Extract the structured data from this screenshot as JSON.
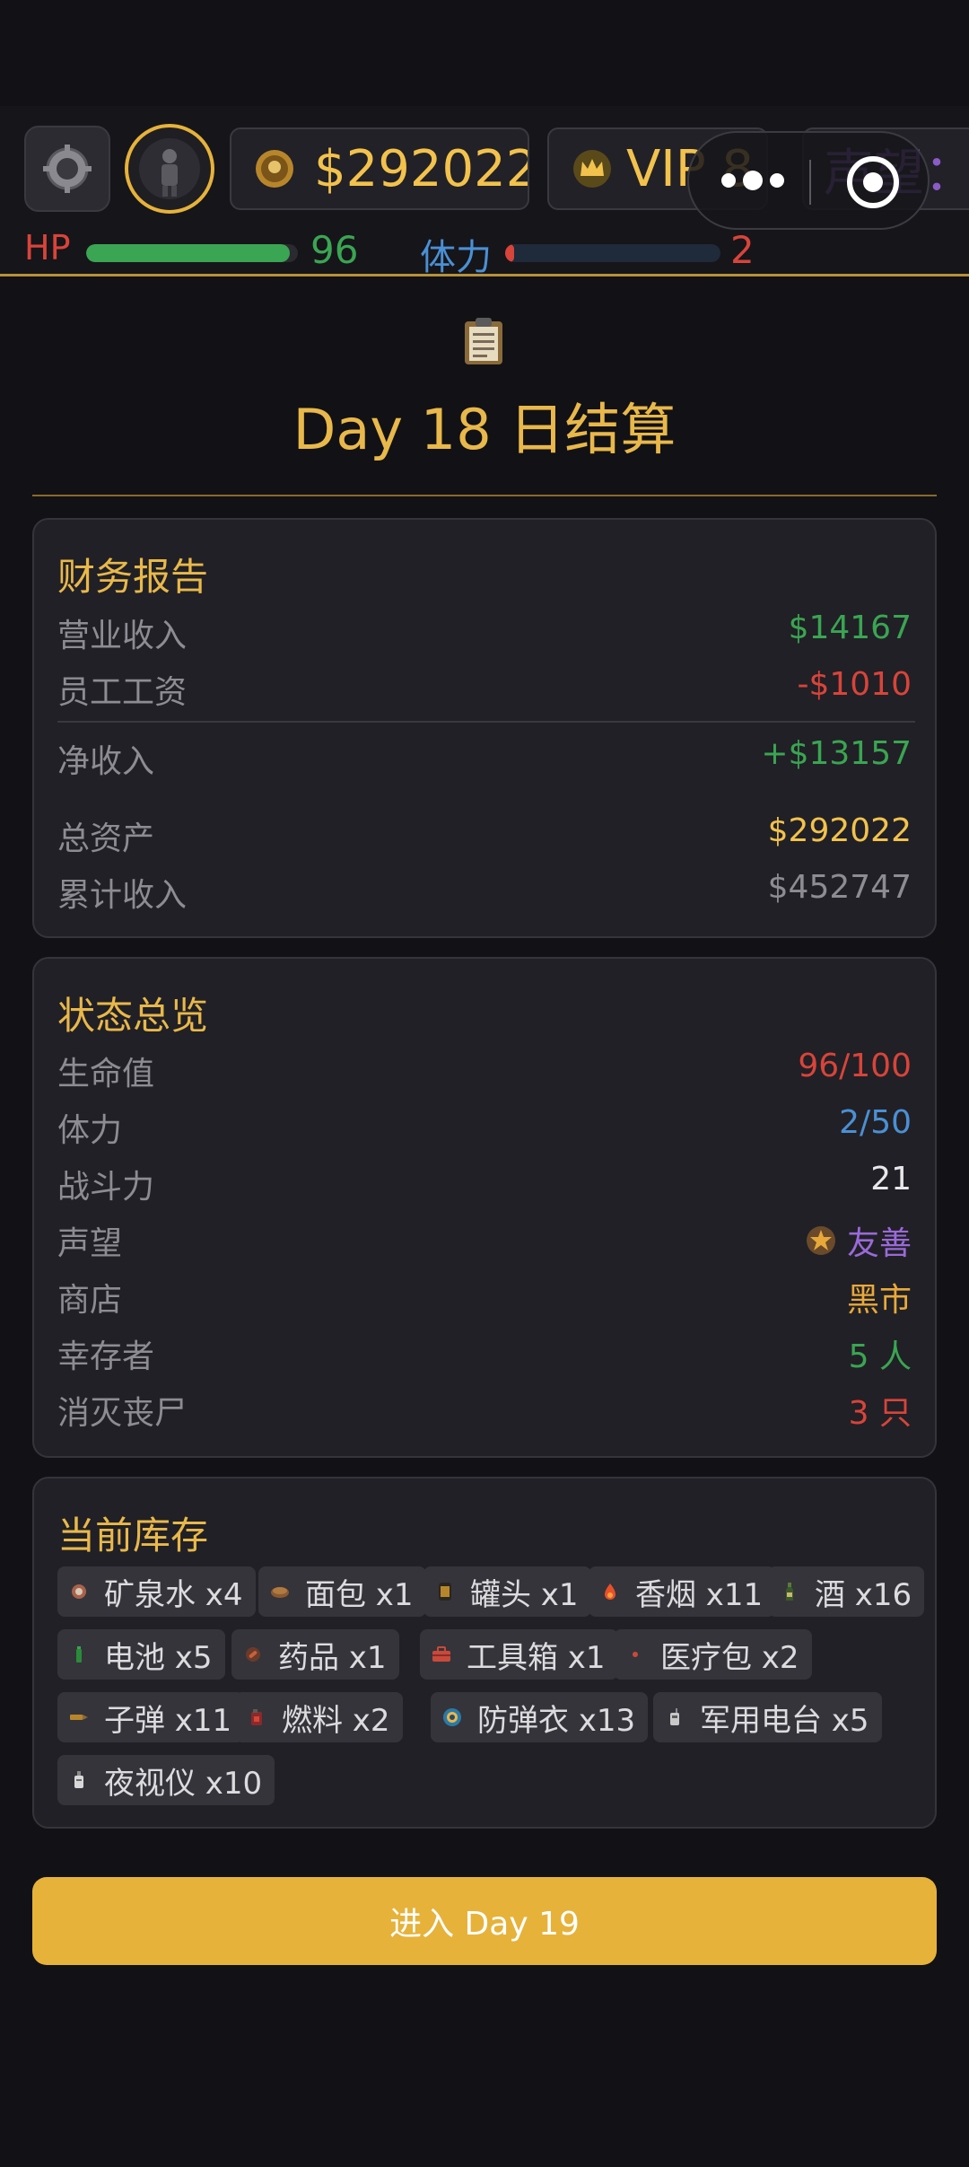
{
  "header": {
    "money": "$292022",
    "vip": "VIP 8",
    "reputation_pill": "声望：",
    "hp_label": "HP",
    "hp_value": "96",
    "hp_fraction": 0.96,
    "stamina_label": "体力",
    "stamina_value": "2",
    "stamina_fraction": 0.04
  },
  "title": "Day 18 日结算",
  "finance": {
    "title": "财务报告",
    "rows": [
      {
        "label": "营业收入",
        "value": "$14167"
      },
      {
        "label": "员工工资",
        "value": "-$1010"
      },
      {
        "label": "净收入",
        "value": "+$13157"
      },
      {
        "label": "总资产",
        "value": "$292022"
      },
      {
        "label": "累计收入",
        "value": "$452747"
      }
    ]
  },
  "status": {
    "title": "状态总览",
    "rows": [
      {
        "label": "生命值",
        "value": "96/100"
      },
      {
        "label": "体力",
        "value": "2/50"
      },
      {
        "label": "战斗力",
        "value": "21"
      },
      {
        "label": "声望",
        "value": "友善"
      },
      {
        "label": "商店",
        "value": "黑市"
      },
      {
        "label": "幸存者",
        "value": "5 人"
      },
      {
        "label": "消灭丧尸",
        "value": "3 只"
      }
    ]
  },
  "inventory": {
    "title": "当前库存",
    "items": [
      {
        "text": "矿泉水 x4",
        "icon": "water-bottle-icon"
      },
      {
        "text": "面包 x1",
        "icon": "bread-icon"
      },
      {
        "text": "罐头 x1",
        "icon": "can-icon"
      },
      {
        "text": "香烟 x11",
        "icon": "cigarette-icon"
      },
      {
        "text": "酒 x16",
        "icon": "liquor-icon"
      },
      {
        "text": "电池 x5",
        "icon": "battery-icon"
      },
      {
        "text": "药品 x1",
        "icon": "medicine-icon"
      },
      {
        "text": "工具箱 x1",
        "icon": "toolbox-icon"
      },
      {
        "text": "医疗包 x2",
        "icon": "medkit-icon"
      },
      {
        "text": "子弹 x11",
        "icon": "bullet-icon"
      },
      {
        "text": "燃料 x2",
        "icon": "fuel-icon"
      },
      {
        "text": "防弹衣 x13",
        "icon": "vest-icon"
      },
      {
        "text": "军用电台 x5",
        "icon": "radio-icon"
      },
      {
        "text": "夜视仪 x10",
        "icon": "goggles-icon"
      }
    ]
  },
  "next_button": "进入 Day 19",
  "colors": {
    "accent": "#e6b23a",
    "positive": "#3aa552",
    "negative": "#d8443a",
    "stamina": "#4a90d4",
    "reputation": "#9a6ad8"
  }
}
